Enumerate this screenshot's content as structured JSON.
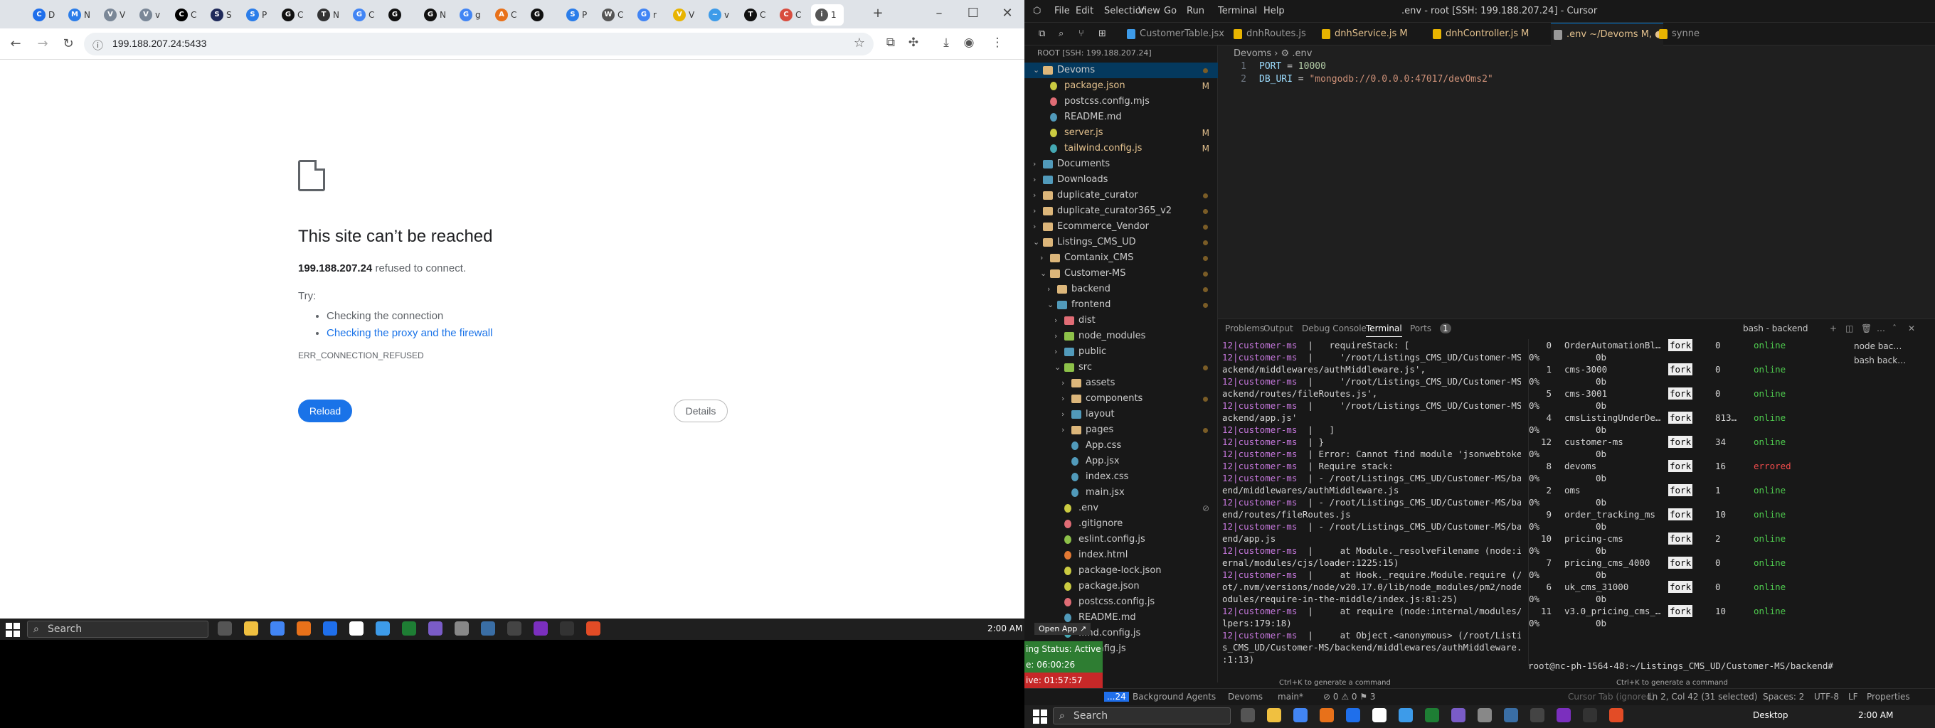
{
  "chrome": {
    "tabs": [
      {
        "label": "D",
        "color": "#1f6feb",
        "glyph": "C"
      },
      {
        "label": "N",
        "color": "#2b7de9",
        "glyph": "M"
      },
      {
        "label": "V",
        "color": "#7a8797",
        "glyph": "V"
      },
      {
        "label": "v",
        "color": "#7a8797",
        "glyph": "V"
      },
      {
        "label": "C",
        "color": "#000000",
        "glyph": "C"
      },
      {
        "label": "S",
        "color": "#1f2a5a",
        "glyph": "S"
      },
      {
        "label": "P",
        "color": "#2b7de9",
        "glyph": "S"
      },
      {
        "label": "C",
        "color": "#111111",
        "glyph": "G"
      },
      {
        "label": "N",
        "color": "#333333",
        "glyph": "T"
      },
      {
        "label": "C",
        "color": "#4285f4",
        "glyph": "G"
      },
      {
        "label": "",
        "color": "#111111",
        "glyph": "G"
      },
      {
        "label": "N",
        "color": "#111111",
        "glyph": "G"
      },
      {
        "label": "g",
        "color": "#4285f4",
        "glyph": "G"
      },
      {
        "label": "C",
        "color": "#e8711a",
        "glyph": "A"
      },
      {
        "label": "",
        "color": "#111111",
        "glyph": "G"
      },
      {
        "label": "P",
        "color": "#2b7de9",
        "glyph": "S"
      },
      {
        "label": "C",
        "color": "#555555",
        "glyph": "W"
      },
      {
        "label": "r",
        "color": "#4285f4",
        "glyph": "G"
      },
      {
        "label": "V",
        "color": "#e8b400",
        "glyph": "V"
      },
      {
        "label": "v",
        "color": "#3d9be9",
        "glyph": "~"
      },
      {
        "label": "C",
        "color": "#111111",
        "glyph": "T"
      },
      {
        "label": "C",
        "color": "#d84d3f",
        "glyph": "C"
      },
      {
        "label": "1",
        "color": "#555555",
        "glyph": "i"
      }
    ],
    "url": "199.188.207.24:5433",
    "error": {
      "title": "This site can’t be reached",
      "host": "199.188.207.24",
      "host_suffix": " refused to connect.",
      "try_label": "Try:",
      "suggestions": [
        "Checking the connection",
        "Checking the proxy and the firewall"
      ],
      "code": "ERR_CONNECTION_REFUSED",
      "reload": "Reload",
      "details": "Details"
    }
  },
  "taskbar_left": {
    "search": "Search",
    "time": "2:00 AM"
  },
  "taskbar_right": {
    "search": "Search",
    "desktop": "Desktop",
    "time": "2:00 AM"
  },
  "ide": {
    "menu": [
      "File",
      "Edit",
      "Selection",
      "View",
      "Go",
      "Run",
      "Terminal",
      "Help"
    ],
    "window_title": ".env - root [SSH: 199.188.207.24] - Cursor",
    "tabs": [
      {
        "label": "CustomerTable.jsx",
        "mod": false,
        "color": "#3d9be9"
      },
      {
        "label": "dnhRoutes.js",
        "mod": false,
        "color": "#e8b400"
      },
      {
        "label": "dnhService.js M",
        "mod": true,
        "color": "#e8b400"
      },
      {
        "label": "dnhController.js M",
        "mod": true,
        "color": "#e8b400"
      },
      {
        "label": ".env ~/Devoms M, ●",
        "mod": true,
        "color": "#999999",
        "active": true
      },
      {
        "label": "synne",
        "mod": false,
        "color": "#e8b400"
      }
    ],
    "explorer_head": "ROOT [SSH: 199.188.207.24]",
    "tree": [
      {
        "depth": 0,
        "chev": "⌄",
        "label": "Devoms",
        "type": "folder",
        "color": "#dcb67a",
        "sel": true,
        "dot": true
      },
      {
        "depth": 1,
        "label": "package.json",
        "type": "file",
        "color": "#cbcb41",
        "badge": "M"
      },
      {
        "depth": 1,
        "label": "postcss.config.mjs",
        "type": "file",
        "color": "#e06c75"
      },
      {
        "depth": 1,
        "label": "README.md",
        "type": "file",
        "color": "#519aba"
      },
      {
        "depth": 1,
        "label": "server.js",
        "type": "file",
        "color": "#cbcb41",
        "badge": "M"
      },
      {
        "depth": 1,
        "label": "tailwind.config.js",
        "type": "file",
        "color": "#44a8b3",
        "badge": "M"
      },
      {
        "depth": 0,
        "chev": "›",
        "label": "Documents",
        "type": "folder",
        "color": "#519aba"
      },
      {
        "depth": 0,
        "chev": "›",
        "label": "Downloads",
        "type": "folder",
        "color": "#519aba"
      },
      {
        "depth": 0,
        "chev": "›",
        "label": "duplicate_curator",
        "type": "folder",
        "color": "#dcb67a",
        "dot": true
      },
      {
        "depth": 0,
        "chev": "›",
        "label": "duplicate_curator365_v2",
        "type": "folder",
        "color": "#dcb67a",
        "dot": true
      },
      {
        "depth": 0,
        "chev": "›",
        "label": "Ecommerce_Vendor",
        "type": "folder",
        "color": "#dcb67a",
        "dot": true
      },
      {
        "depth": 0,
        "chev": "⌄",
        "label": "Listings_CMS_UD",
        "type": "folder",
        "color": "#dcb67a",
        "dot": true
      },
      {
        "depth": 1,
        "chev": "›",
        "label": "Comtanix_CMS",
        "type": "folder",
        "color": "#dcb67a",
        "dot": true
      },
      {
        "depth": 1,
        "chev": "⌄",
        "label": "Customer-MS",
        "type": "folder",
        "color": "#dcb67a",
        "dot": true
      },
      {
        "depth": 2,
        "chev": "›",
        "label": "backend",
        "type": "folder",
        "color": "#dcb67a",
        "dot": true
      },
      {
        "depth": 2,
        "chev": "⌄",
        "label": "frontend",
        "type": "folder",
        "color": "#519aba",
        "dot": true
      },
      {
        "depth": 3,
        "chev": "›",
        "label": "dist",
        "type": "folder",
        "color": "#e06c75"
      },
      {
        "depth": 3,
        "chev": "›",
        "label": "node_modules",
        "type": "folder",
        "color": "#8dc149"
      },
      {
        "depth": 3,
        "chev": "›",
        "label": "public",
        "type": "folder",
        "color": "#519aba"
      },
      {
        "depth": 3,
        "chev": "⌄",
        "label": "src",
        "type": "folder",
        "color": "#8dc149",
        "dot": true
      },
      {
        "depth": 4,
        "chev": "›",
        "label": "assets",
        "type": "folder",
        "color": "#dcb67a"
      },
      {
        "depth": 4,
        "chev": "›",
        "label": "components",
        "type": "folder",
        "color": "#dcb67a",
        "dot": true
      },
      {
        "depth": 4,
        "chev": "›",
        "label": "layout",
        "type": "folder",
        "color": "#519aba"
      },
      {
        "depth": 4,
        "chev": "›",
        "label": "pages",
        "type": "folder",
        "color": "#dcb67a",
        "dot": true
      },
      {
        "depth": 4,
        "label": "App.css",
        "type": "file",
        "color": "#519aba"
      },
      {
        "depth": 4,
        "label": "App.jsx",
        "type": "file",
        "color": "#519aba"
      },
      {
        "depth": 4,
        "label": "index.css",
        "type": "file",
        "color": "#519aba"
      },
      {
        "depth": 4,
        "label": "main.jsx",
        "type": "file",
        "color": "#519aba"
      },
      {
        "depth": 3,
        "label": ".env",
        "type": "file",
        "color": "#cbcb41",
        "badge": "⊘"
      },
      {
        "depth": 3,
        "label": ".gitignore",
        "type": "file",
        "color": "#e06c75"
      },
      {
        "depth": 3,
        "label": "eslint.config.js",
        "type": "file",
        "color": "#8dc149"
      },
      {
        "depth": 3,
        "label": "index.html",
        "type": "file",
        "color": "#e37933"
      },
      {
        "depth": 3,
        "label": "package-lock.json",
        "type": "file",
        "color": "#cbcb41"
      },
      {
        "depth": 3,
        "label": "package.json",
        "type": "file",
        "color": "#cbcb41"
      },
      {
        "depth": 3,
        "label": "postcss.config.js",
        "type": "file",
        "color": "#e06c75"
      },
      {
        "depth": 3,
        "label": "README.md",
        "type": "file",
        "color": "#519aba"
      },
      {
        "depth": 3,
        "label": "...nd.config.js",
        "type": "file",
        "color": "#44a8b3"
      },
      {
        "depth": 3,
        "label": "...config.js",
        "type": "file",
        "color": "#cbcb41"
      }
    ],
    "breadcrumb": "Devoms  ›  ⚙ .env",
    "code": [
      {
        "key": "PORT",
        "val": "10000",
        "kind": "num"
      },
      {
        "key": "DB_URI",
        "val": "\"mongodb://0.0.0.0:47017/devOms2\"",
        "kind": "str"
      }
    ],
    "panel_tabs": [
      "Problems",
      "Output",
      "Debug Console",
      "Terminal",
      "Ports"
    ],
    "ports_count": "1",
    "terminal_name": "bash - backend",
    "term_lines": [
      [
        "12|customer-ms",
        "  |   requireStack: ["
      ],
      [
        "12|customer-ms",
        "  |     '/root/Listings_CMS_UD/Customer-MS/b"
      ],
      [
        "",
        "ackend/middlewares/authMiddleware.js',"
      ],
      [
        "12|customer-ms",
        "  |     '/root/Listings_CMS_UD/Customer-MS/b"
      ],
      [
        "",
        "ackend/routes/fileRoutes.js',"
      ],
      [
        "12|customer-ms",
        "  |     '/root/Listings_CMS_UD/Customer-MS/b"
      ],
      [
        "",
        "ackend/app.js'"
      ],
      [
        "12|customer-ms",
        "  |   ]"
      ],
      [
        "12|customer-ms",
        "  | }"
      ],
      [
        "12|customer-ms",
        "  | Error: Cannot find module 'jsonwebtoken'"
      ],
      [
        "12|customer-ms",
        "  | Require stack:"
      ],
      [
        "12|customer-ms",
        "  | - /root/Listings_CMS_UD/Customer-MS/back"
      ],
      [
        "",
        "end/middlewares/authMiddleware.js"
      ],
      [
        "12|customer-ms",
        "  | - /root/Listings_CMS_UD/Customer-MS/back"
      ],
      [
        "",
        "end/routes/fileRoutes.js"
      ],
      [
        "12|customer-ms",
        "  | - /root/Listings_CMS_UD/Customer-MS/back"
      ],
      [
        "",
        "end/app.js"
      ],
      [
        "12|customer-ms",
        "  |     at Module._resolveFilename (node:int"
      ],
      [
        "",
        "ernal/modules/cjs/loader:1225:15)"
      ],
      [
        "12|customer-ms",
        "  |     at Hook._require.Module.require (/ro"
      ],
      [
        "",
        "ot/.nvm/versions/node/v20.17.0/lib/node_modules/pm2/node_m"
      ],
      [
        "",
        "odules/require-in-the-middle/index.js:81:25)"
      ],
      [
        "12|customer-ms",
        "  |     at require (node:internal/modules/he"
      ],
      [
        "",
        "lpers:179:18)"
      ],
      [
        "12|customer-ms",
        "  |     at Object.<anonymous> (/root/Listing"
      ],
      [
        "",
        "s_CMS_UD/Customer-MS/backend/middlewares/authMiddleware.js"
      ],
      [
        "",
        ":1:13)"
      ]
    ],
    "pm2": [
      {
        "id": "0",
        "name": "OrderAutomationBl…",
        "restarts": "0",
        "status": "online"
      },
      {
        "id": "1",
        "name": "cms-3000",
        "restarts": "0",
        "status": "online"
      },
      {
        "id": "5",
        "name": "cms-3001",
        "restarts": "0",
        "status": "online"
      },
      {
        "id": "4",
        "name": "cmsListingUnderDe…",
        "restarts": "813…",
        "status": "online"
      },
      {
        "id": "12",
        "name": "customer-ms",
        "restarts": "34",
        "status": "online"
      },
      {
        "id": "8",
        "name": "devoms",
        "restarts": "16",
        "status": "errored"
      },
      {
        "id": "2",
        "name": "oms",
        "restarts": "1",
        "status": "online"
      },
      {
        "id": "9",
        "name": "order_tracking_ms",
        "restarts": "10",
        "status": "online"
      },
      {
        "id": "10",
        "name": "pricing-cms",
        "restarts": "2",
        "status": "online"
      },
      {
        "id": "7",
        "name": "pricing_cms_4000",
        "restarts": "0",
        "status": "online"
      },
      {
        "id": "6",
        "name": "uk_cms_31000",
        "restarts": "0",
        "status": "online"
      },
      {
        "id": "11",
        "name": "v3.0_pricing_cms_…",
        "restarts": "10",
        "status": "online"
      }
    ],
    "pm2_mode": "fork",
    "pm2_sub": "0b",
    "pm2_pct": "0%",
    "term_list": [
      "node  bac…",
      "bash  back…"
    ],
    "prompt": "root@nc-ph-1564-48:~/Listings_CMS_UD/Customer-MS/backend#",
    "hint": "Ctrl+K to generate a command",
    "open_app": "Open App ↗",
    "status_boxes": [
      {
        "label": "ing Status: Active",
        "color": "#2e7d32"
      },
      {
        "label": "e: 06:00:26",
        "color": "#2e7d32"
      },
      {
        "label": "ive: 01:57:57",
        "color": "#c62828"
      }
    ],
    "statusbar": {
      "left": "...24",
      "agents": "Background Agents",
      "folder": "Devoms",
      "branch": "main*",
      "problems": "⊘ 0 ⚠ 0  ⚑ 3",
      "cursor": "Ln 2, Col 42 (31 selected)",
      "spaces": "Spaces: 2",
      "enc": "UTF-8",
      "eol": "LF",
      "lang": "Properties",
      "tab_ignored": "Cursor Tab (ignored)"
    }
  }
}
